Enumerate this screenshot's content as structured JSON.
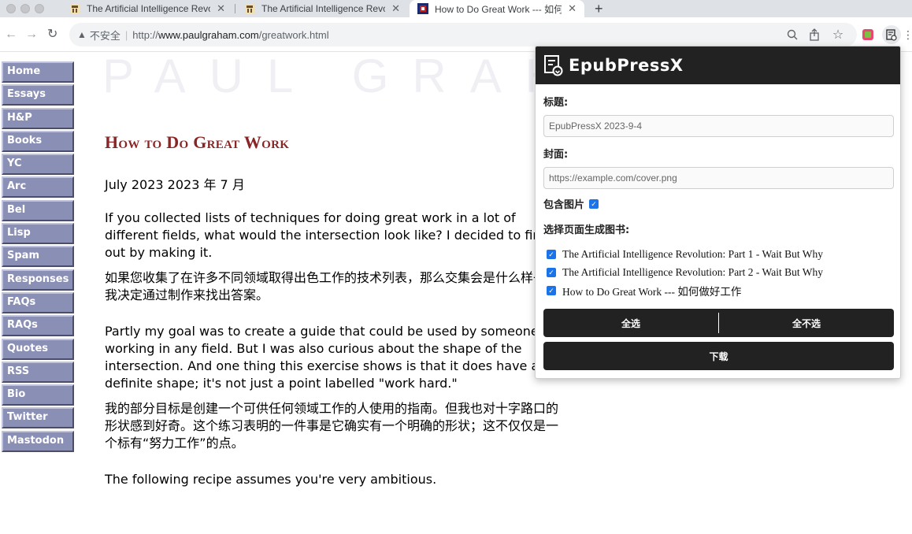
{
  "browser": {
    "tabs": [
      {
        "title": "The Artificial Intelligence Revol",
        "active": false,
        "favicon": "waitbutwhy-favicon"
      },
      {
        "title": "The Artificial Intelligence Revol",
        "active": false,
        "favicon": "waitbutwhy-favicon"
      },
      {
        "title": "How to Do Great Work --- 如何",
        "active": true,
        "favicon": "paulgraham-favicon"
      }
    ],
    "new_tab": "+",
    "security_label": "不安全",
    "url_prefix": "http://",
    "url_host": "www.paulgraham.com",
    "url_path": "/greatwork.html"
  },
  "sidebar": {
    "items": [
      "Home",
      "Essays",
      "H&P",
      "Books",
      "YC",
      "Arc",
      "Bel",
      "Lisp",
      "Spam",
      "Responses",
      "FAQs",
      "RAQs",
      "Quotes",
      "RSS",
      "Bio",
      "Twitter",
      "Mastodon"
    ]
  },
  "site": {
    "logo_text": "PAUL GRAHAM"
  },
  "article": {
    "title": "How to Do Great Work",
    "date": "July 2023 2023 年 7 月",
    "paragraphs": [
      {
        "lang": "en",
        "text": "If you collected lists of techniques for doing great work in a lot of different fields, what would the intersection look like? I decided to find out by making it."
      },
      {
        "lang": "zh",
        "text": "如果您收集了在许多不同领域取得出色工作的技术列表，那么交集会是什么样子？我决定通过制作来找出答案。"
      },
      {
        "lang": "en",
        "text": "Partly my goal was to create a guide that could be used by someone working in any field. But I was also curious about the shape of the intersection. And one thing this exercise shows is that it does have a definite shape; it's not just a point labelled \"work hard.\""
      },
      {
        "lang": "zh",
        "text": "我的部分目标是创建一个可供任何领域工作的人使用的指南。但我也对十字路口的形状感到好奇。这个练习表明的一件事是它确实有一个明确的形状；这不仅仅是一个标有“努力工作”的点。"
      },
      {
        "lang": "en",
        "text": "The following recipe assumes you're very ambitious."
      }
    ]
  },
  "popup": {
    "title": "EpubPressX",
    "title_label": "标题:",
    "title_placeholder": "EpubPressX 2023-9-4",
    "cover_label": "封面:",
    "cover_placeholder": "https://example.com/cover.png",
    "include_images_label": "包含图片",
    "include_images_checked": true,
    "select_pages_label": "选择页面生成图书:",
    "pages": [
      {
        "label": "The Artificial Intelligence Revolution: Part 1 - Wait But Why",
        "checked": true
      },
      {
        "label": "The Artificial Intelligence Revolution: Part 2 - Wait But Why",
        "checked": true
      },
      {
        "label": "How to Do Great Work --- 如何做好工作",
        "checked": true
      }
    ],
    "select_all_label": "全选",
    "select_none_label": "全不选",
    "download_label": "下载"
  }
}
